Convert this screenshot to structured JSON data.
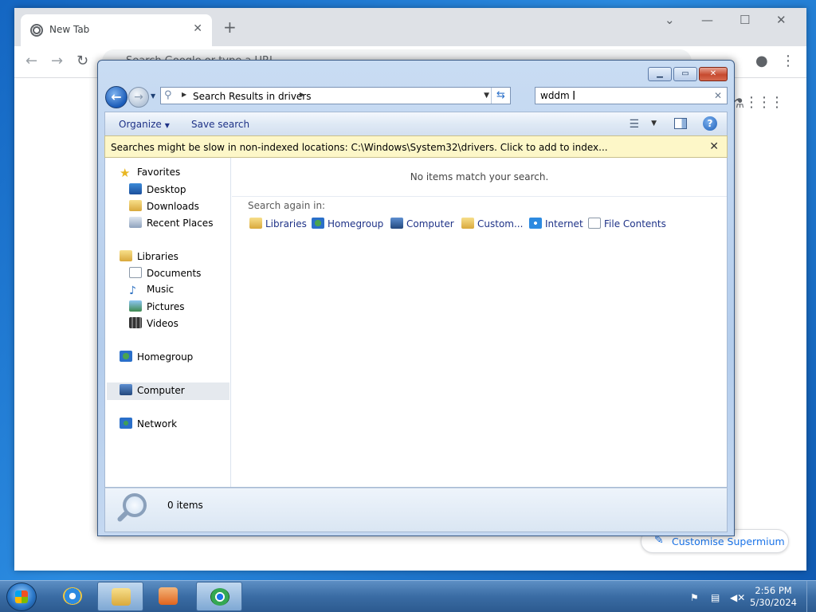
{
  "browser": {
    "tab_title": "New Tab",
    "omnibox_placeholder": "Search Google or type a URL",
    "customise_label": "Customise Supermium"
  },
  "explorer": {
    "address": {
      "segment1": "Search Results in drivers"
    },
    "search": {
      "value": "wddm"
    },
    "toolbar": {
      "organize_label": "Organize",
      "save_search_label": "Save search"
    },
    "infobar": {
      "message": "Searches might be slow in non-indexed locations: C:\\Windows\\System32\\drivers. Click to add to index..."
    },
    "nav": {
      "favorites": "Favorites",
      "desktop": "Desktop",
      "downloads": "Downloads",
      "recent_places": "Recent Places",
      "libraries": "Libraries",
      "documents": "Documents",
      "music": "Music",
      "pictures": "Pictures",
      "videos": "Videos",
      "homegroup": "Homegroup",
      "computer": "Computer",
      "network": "Network"
    },
    "results": {
      "no_items": "No items match your search.",
      "search_again": "Search again in:",
      "locations": [
        "Libraries",
        "Homegroup",
        "Computer",
        "Custom...",
        "Internet",
        "File Contents"
      ]
    },
    "details": {
      "count": "0 items"
    }
  },
  "taskbar": {
    "time": "2:56 PM",
    "date": "5/30/2024"
  }
}
